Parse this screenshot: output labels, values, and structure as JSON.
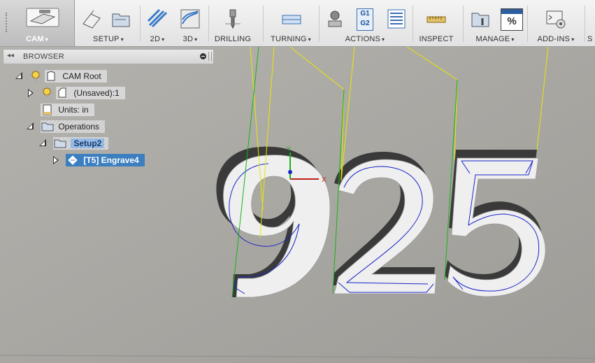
{
  "toolbar": {
    "groups": [
      {
        "label": "CAM",
        "caret": "▾"
      },
      {
        "label": "SETUP",
        "caret": "▾"
      },
      {
        "label": "2D",
        "caret": "▾"
      },
      {
        "label": "3D",
        "caret": "▾"
      },
      {
        "label": "DRILLING",
        "caret": ""
      },
      {
        "label": "TURNING",
        "caret": "▾"
      },
      {
        "label": "ACTIONS",
        "caret": "▾"
      },
      {
        "label": "INSPECT",
        "caret": ""
      },
      {
        "label": "MANAGE",
        "caret": "▾"
      },
      {
        "label": "ADD-INS",
        "caret": "▾"
      }
    ],
    "gcode_icon_text": [
      "G1",
      "G2"
    ],
    "percent_icon_text": "%",
    "overflow_text": "S"
  },
  "browser": {
    "title": "BROWSER",
    "tree": [
      {
        "label": "CAM Root"
      },
      {
        "label": "(Unsaved):1"
      },
      {
        "label": "Units: in"
      },
      {
        "label": "Operations"
      },
      {
        "label": "Setup2"
      },
      {
        "label": "[T5] Engrave4"
      }
    ]
  },
  "viewport": {
    "text_3d": "925",
    "triad_axes": [
      "X",
      "Y"
    ],
    "colors": {
      "background": "#a5a39f",
      "part_face": "#efefef",
      "part_wall": "#3c3c3c",
      "toolpath": "#1a24c8",
      "rapid": "#e8e800",
      "lead": "#15b515",
      "selection": "#3c7fc0"
    }
  }
}
